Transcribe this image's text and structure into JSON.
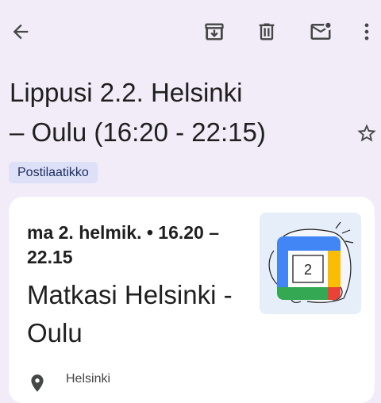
{
  "toolbar": {
    "back_icon": "arrow-left-icon",
    "archive_icon": "archive-icon",
    "delete_icon": "trash-icon",
    "mark_unread_icon": "mail-unread-icon",
    "more_icon": "more-vert-icon"
  },
  "email": {
    "subject_line1": "Lippusi 2.2. Helsinki",
    "subject_line2": "– Oulu (16:20 - 22:15)",
    "label": "Postilaatikko",
    "star_icon": "star-outline-icon"
  },
  "event_card": {
    "time": "ma 2. helmik. • 16.20 – 22.15",
    "title": "Matkasi Helsinki - Oulu",
    "calendar_day": "2",
    "location_icon": "location-pin-icon",
    "location_text": "Helsinki"
  },
  "colors": {
    "background": "#f1ecf7",
    "chip_background": "#dde0f7",
    "card_background": "#ffffff",
    "google_blue": "#4285f4",
    "google_green": "#34a853",
    "google_yellow": "#fbbc04",
    "google_red": "#ea4335"
  }
}
